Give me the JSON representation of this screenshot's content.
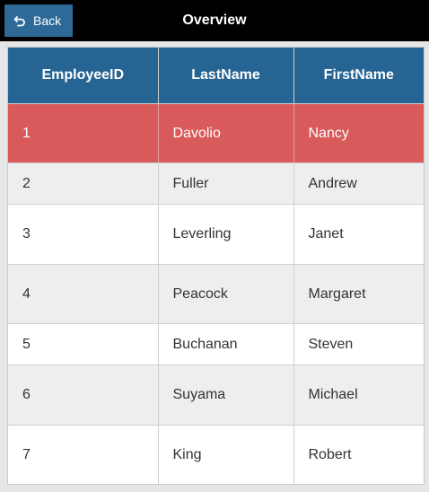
{
  "header": {
    "title": "Overview",
    "back_label": "Back"
  },
  "grid": {
    "columns": [
      "EmployeeID",
      "LastName",
      "FirstName"
    ],
    "rows": [
      {
        "id": "1",
        "last": "Davolio",
        "first": "Nancy",
        "selected": true
      },
      {
        "id": "2",
        "last": "Fuller",
        "first": "Andrew",
        "selected": false
      },
      {
        "id": "3",
        "last": "Leverling",
        "first": "Janet",
        "selected": false
      },
      {
        "id": "4",
        "last": "Peacock",
        "first": "Margaret",
        "selected": false
      },
      {
        "id": "5",
        "last": "Buchanan",
        "first": "Steven",
        "selected": false
      },
      {
        "id": "6",
        "last": "Suyama",
        "first": "Michael",
        "selected": false
      },
      {
        "id": "7",
        "last": "King",
        "first": "Robert",
        "selected": false
      }
    ]
  },
  "colors": {
    "header_bg": "#266593",
    "selected_row": "#d85a5a",
    "alt_row": "#eeeeee",
    "topbar": "#000000",
    "back_button": "#2d6a97"
  },
  "icons": {
    "back": "undo-arrow-icon"
  }
}
